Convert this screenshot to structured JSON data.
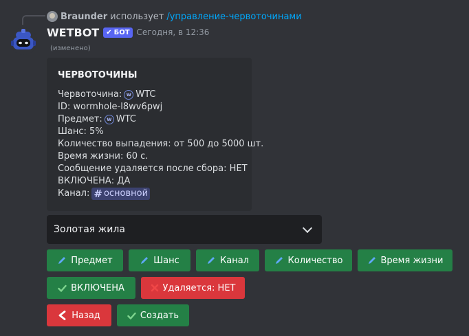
{
  "reply": {
    "user": "Braunder",
    "text": "использует",
    "command": "/управление-червоточинами"
  },
  "message": {
    "username": "WETBOT",
    "badge": "БОТ",
    "timestamp": "Сегодня, в 12:36",
    "edited": "(изменено)"
  },
  "embed": {
    "title": "ЧЕРВОТОЧИНЫ",
    "fields": [
      {
        "label": "Червоточина:",
        "emoji": "w",
        "value": "WTC"
      },
      {
        "label": "ID:",
        "value": "wormhole-l8wv6pwj"
      },
      {
        "label": "Предмет:",
        "emoji": "w",
        "value": "WTC"
      },
      {
        "label": "Шанс:",
        "value": "5%"
      },
      {
        "label": "Количество выпадения:",
        "value": "от 500 до 5000 шт."
      },
      {
        "label": "Время жизни:",
        "value": "60 с."
      },
      {
        "label": "Сообщение удаляется после сбора:",
        "value": "НЕТ"
      },
      {
        "label": "ВКЛЮЧЕНА:",
        "value": "ДА"
      },
      {
        "label": "Канал:",
        "channel": "основной"
      }
    ]
  },
  "select": {
    "value": "Золотая жила"
  },
  "buttons": {
    "item": "Предмет",
    "chance": "Шанс",
    "channel": "Канал",
    "amount": "Количество",
    "lifetime": "Время жизни",
    "enabled": "ВКЛЮЧЕНА",
    "deletes": "Удаляется: НЕТ",
    "back": "Назад",
    "create": "Создать"
  },
  "icons": {
    "pencil": "pencil-icon",
    "check": "check-icon",
    "cross": "cross-icon",
    "back": "back-arrow-icon"
  },
  "colors": {
    "green": "#248046",
    "red": "#da373c",
    "blurple": "#5865f2",
    "link": "#00a8fc"
  }
}
